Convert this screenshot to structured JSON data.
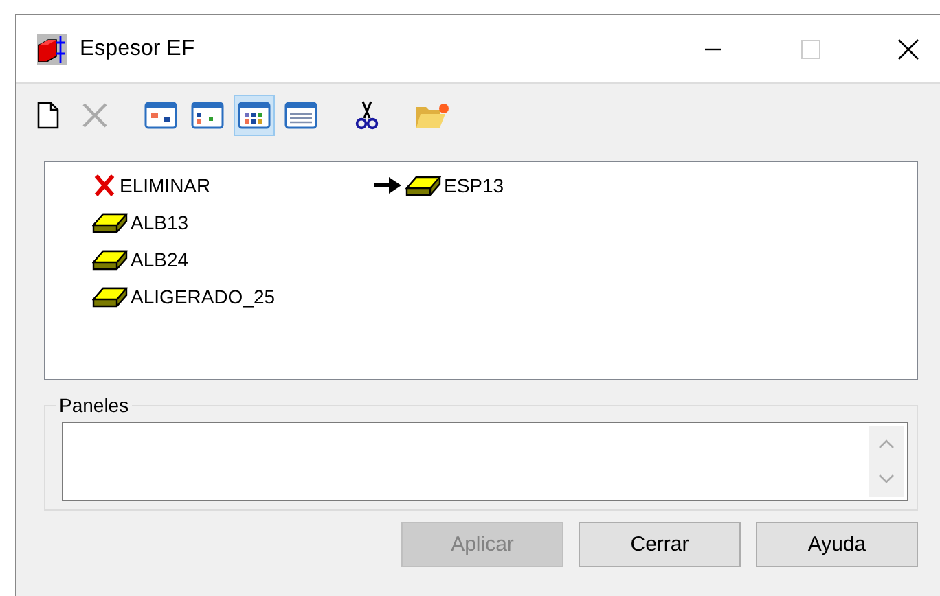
{
  "window": {
    "title": "Espesor EF"
  },
  "toolbar": [
    {
      "kind": "new",
      "disabled": false,
      "selected": false
    },
    {
      "kind": "delete",
      "disabled": true,
      "selected": false
    },
    {
      "kind": "view-large",
      "disabled": false,
      "selected": false
    },
    {
      "kind": "view-small",
      "disabled": false,
      "selected": false
    },
    {
      "kind": "view-list",
      "disabled": false,
      "selected": true
    },
    {
      "kind": "view-details",
      "disabled": false,
      "selected": false
    },
    {
      "kind": "cut",
      "disabled": false,
      "selected": false
    },
    {
      "kind": "folder",
      "disabled": false,
      "selected": false
    }
  ],
  "items": [
    {
      "label": "ELIMINAR",
      "kind": "delete",
      "target": {
        "label": "ESP13",
        "kind": "slab"
      }
    },
    {
      "label": "ALB13",
      "kind": "slab"
    },
    {
      "label": "ALB24",
      "kind": "slab"
    },
    {
      "label": "ALIGERADO_25",
      "kind": "slab"
    }
  ],
  "panels": {
    "title": "Paneles"
  },
  "buttons": [
    {
      "label": "Aplicar",
      "disabled": true
    },
    {
      "label": "Cerrar",
      "disabled": false
    },
    {
      "label": "Ayuda",
      "disabled": false
    }
  ]
}
